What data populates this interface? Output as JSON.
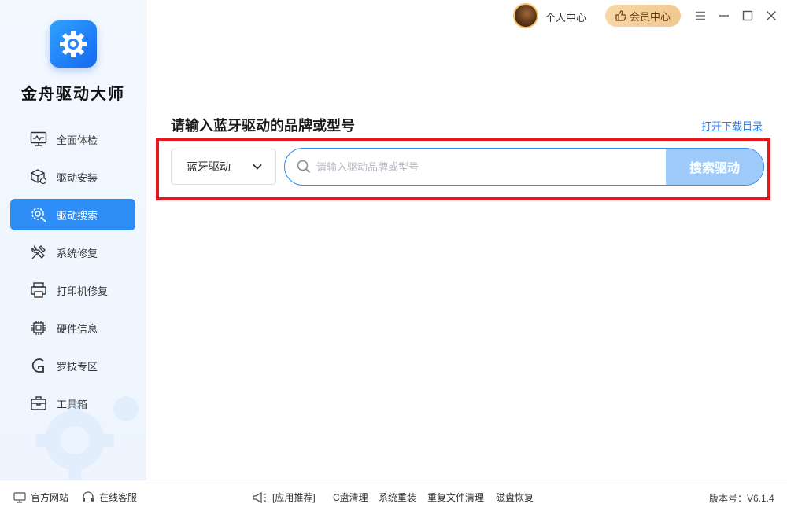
{
  "app": {
    "name": "金舟驱动大师"
  },
  "topbar": {
    "user_center": "个人中心",
    "vip_label": "会员中心"
  },
  "sidebar": {
    "items": [
      {
        "label": "全面体检",
        "icon": "monitor-check-icon"
      },
      {
        "label": "驱动安装",
        "icon": "package-gear-icon"
      },
      {
        "label": "驱动搜索",
        "icon": "gear-search-icon",
        "active": true
      },
      {
        "label": "系统修复",
        "icon": "tools-icon"
      },
      {
        "label": "打印机修复",
        "icon": "printer-icon"
      },
      {
        "label": "硬件信息",
        "icon": "chip-icon"
      },
      {
        "label": "罗技专区",
        "icon": "logitech-icon"
      },
      {
        "label": "工具箱",
        "icon": "toolbox-icon"
      }
    ]
  },
  "main": {
    "title": "请输入蓝牙驱动的品牌或型号",
    "download_link": "打开下载目录",
    "dropdown_value": "蓝牙驱动",
    "search_placeholder": "请输入驱动品牌或型号",
    "search_button": "搜索驱动"
  },
  "footer": {
    "official_site": "官方网站",
    "online_service": "在线客服",
    "recommend": "[应用推荐]",
    "links": [
      "C盘清理",
      "系统重装",
      "重复文件清理",
      "磁盘恢复"
    ],
    "version": "版本号：V6.1.4"
  },
  "colors": {
    "accent": "#2d8cf5",
    "search_button_bg": "#9fcbfa",
    "highlight_border": "#e8161b",
    "vip_bg": "#f0c98e"
  }
}
